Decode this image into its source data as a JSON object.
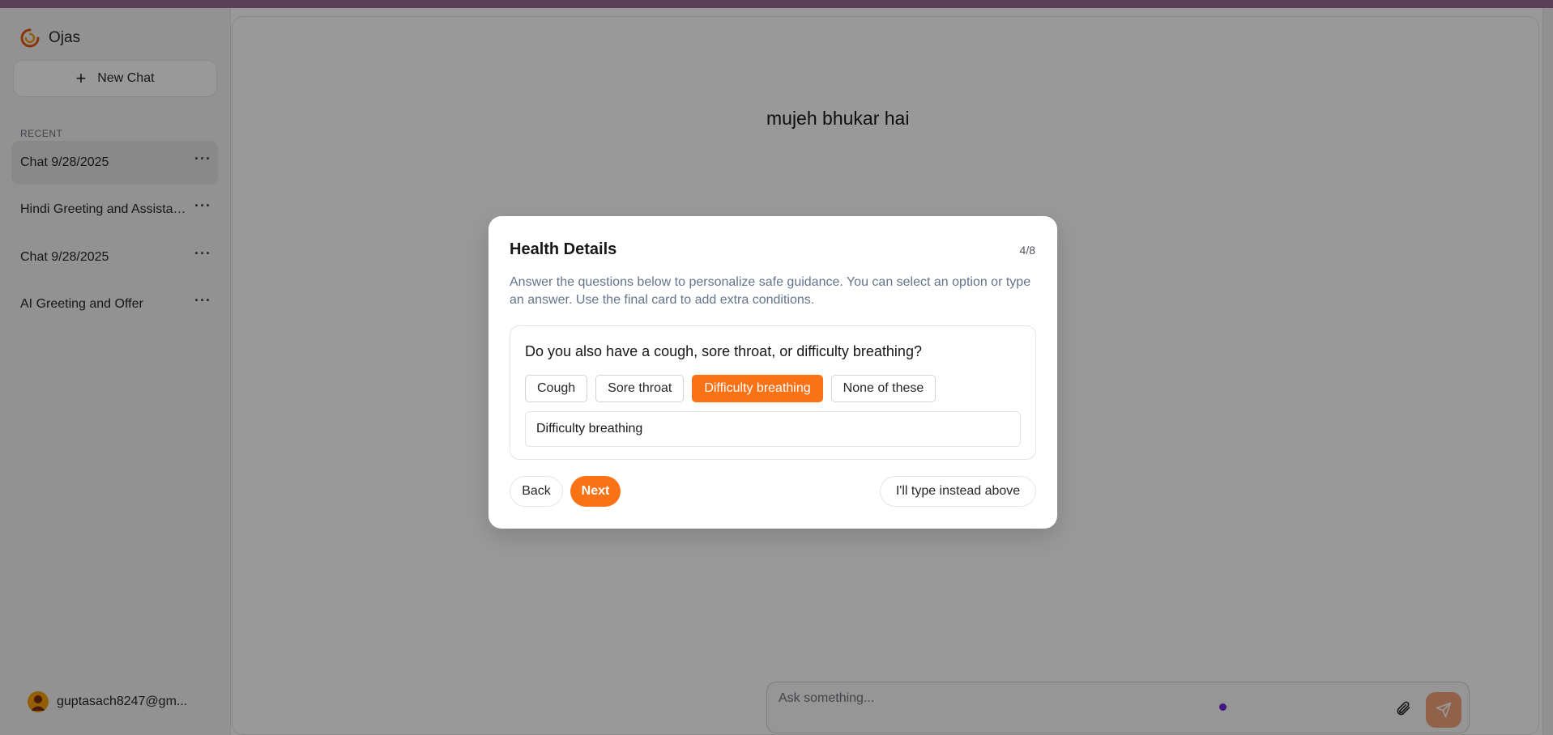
{
  "app": {
    "name": "Ojas"
  },
  "sidebar": {
    "new_chat_label": "New Chat",
    "recent_label": "RECENT",
    "chats": [
      {
        "label": "Chat 9/28/2025",
        "active": true
      },
      {
        "label": "Hindi Greeting and Assistance"
      },
      {
        "label": "Chat 9/28/2025"
      },
      {
        "label": "AI Greeting and Offer"
      }
    ],
    "more_glyph": "···",
    "user_email": "guptasach8247@gm..."
  },
  "conversation": {
    "user_message": "mujeh bhukar hai"
  },
  "composer": {
    "placeholder": "Ask something..."
  },
  "modal": {
    "title": "Health Details",
    "step": "4/8",
    "description": "Answer the questions below to personalize safe guidance. You can select an option or type an answer. Use the final card to add extra conditions.",
    "question": "Do you also have a cough, sore throat, or difficulty breathing?",
    "options": [
      {
        "label": "Cough",
        "selected": false
      },
      {
        "label": "Sore throat",
        "selected": false
      },
      {
        "label": "Difficulty breathing",
        "selected": true
      },
      {
        "label": "None of these",
        "selected": false
      }
    ],
    "answer_value": "Difficulty breathing",
    "back_label": "Back",
    "next_label": "Next",
    "type_instead_label": "I'll type instead above"
  },
  "colors": {
    "accent": "#f97316",
    "topbar": "#5a3e58",
    "send_button": "#f4a27a"
  },
  "icons": {
    "logo": "ojas-logo-icon",
    "plus": "plus-icon",
    "more": "more-horizontal-icon",
    "avatar": "user-avatar-icon",
    "attach": "paperclip-icon",
    "send": "send-icon"
  }
}
